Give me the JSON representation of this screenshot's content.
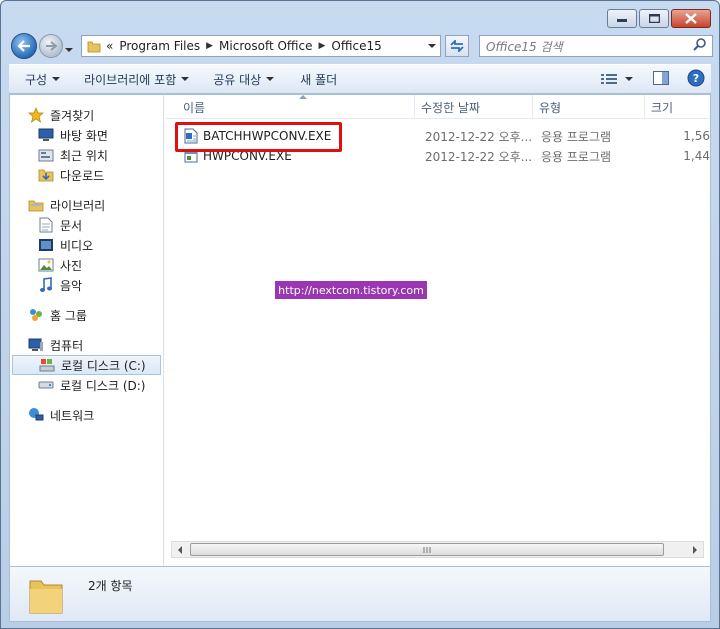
{
  "address": {
    "prefix": "«",
    "crumbs": [
      "Program Files",
      "Microsoft Office",
      "Office15"
    ]
  },
  "search": {
    "placeholder": "Office15 검색"
  },
  "toolbar": {
    "organize": "구성",
    "include_library": "라이브러리에 포함",
    "share": "공유 대상",
    "new_folder": "새 폴더"
  },
  "nav": {
    "favorites": "즐겨찾기",
    "desktop": "바탕 화면",
    "recent": "최근 위치",
    "downloads": "다운로드",
    "libraries": "라이브러리",
    "documents": "문서",
    "videos": "비디오",
    "pictures": "사진",
    "music": "음악",
    "homegroup": "홈 그룹",
    "computer": "컴퓨터",
    "drive_c": "로컬 디스크 (C:)",
    "drive_d": "로컬 디스크 (D:)",
    "network": "네트워크"
  },
  "columns": {
    "name": "이름",
    "date": "수정한 날짜",
    "type": "유형",
    "size": "크기"
  },
  "files": [
    {
      "name": "BATCHHWPCONV.EXE",
      "date": "2012-12-22 오후...",
      "type": "응용 프로그램",
      "size": "1,56"
    },
    {
      "name": "HWPCONV.EXE",
      "date": "2012-12-22 오후...",
      "type": "응용 프로그램",
      "size": "1,44"
    }
  ],
  "watermark": "http://nextcom.tistory.com",
  "status": {
    "item_count": "2개 항목"
  },
  "colors": {
    "highlight": "#e01010",
    "watermark_bg": "#9b36b3"
  }
}
